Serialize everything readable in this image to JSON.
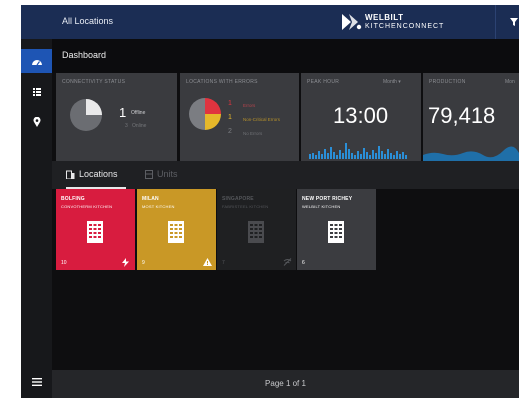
{
  "header": {
    "location_selector": "All Locations",
    "brand_line1": "WELBILT",
    "brand_line2": "KITCHENCONNECT"
  },
  "sidebar": {
    "items": [
      {
        "name": "dashboard",
        "icon": "dashboard-gauge-icon",
        "active": true
      },
      {
        "name": "list",
        "icon": "list-icon",
        "active": false
      },
      {
        "name": "map",
        "icon": "map-pin-icon",
        "active": false
      },
      {
        "name": "menu",
        "icon": "hamburger-menu-icon",
        "active": false
      }
    ]
  },
  "page": {
    "title": "Dashboard"
  },
  "kpis": {
    "connectivity": {
      "label": "CONNECTIVITY STATUS",
      "offline_count": "1",
      "offline_label": "Offline",
      "online_count": "3",
      "online_label": "Online",
      "offline_fraction": 0.25
    },
    "errors": {
      "label": "LOCATIONS WITH ERRORS",
      "rows": [
        {
          "count": "1",
          "label": "Errors",
          "color": "#e0343f"
        },
        {
          "count": "1",
          "label": "Non-Critical Errors",
          "color": "#e6b82a"
        },
        {
          "count": "2",
          "label": "No Errors",
          "color": "#707276"
        }
      ]
    },
    "peak_hour": {
      "label": "PEAK HOUR",
      "metric": "Month",
      "value": "13:00"
    },
    "production": {
      "label": "PRODUCTION",
      "metric": "Mon",
      "value": "79,418"
    }
  },
  "tabs": [
    {
      "label": "Locations",
      "icon": "building-icon",
      "active": true
    },
    {
      "label": "Units",
      "icon": "unit-icon",
      "active": false
    }
  ],
  "locations": [
    {
      "name": "BOLFING",
      "type": "CONVOTHERM KITCHEN",
      "count": "10",
      "status_icon": "lightning-icon",
      "color": "#d81c3f"
    },
    {
      "name": "MILAN",
      "type": "MOST KITCHEN",
      "count": "9",
      "status_icon": "warning-icon",
      "color": "#c99826"
    },
    {
      "name": "SINGAPORE",
      "type": "FABRISTEEL KITCHEN",
      "count": "7",
      "status_icon": "offline-icon",
      "color": "#1f2022"
    },
    {
      "name": "NEW PORT RICHEY",
      "type": "WELBILT KITCHEN",
      "count": "6",
      "status_icon": "",
      "color": "#3b3c40"
    }
  ],
  "pagination": {
    "text": "Page 1 of 1"
  },
  "colors": {
    "header_bg": "#1b2d54",
    "sidebar_active": "#1e55b4",
    "sparkline": "#2a8fd8"
  }
}
